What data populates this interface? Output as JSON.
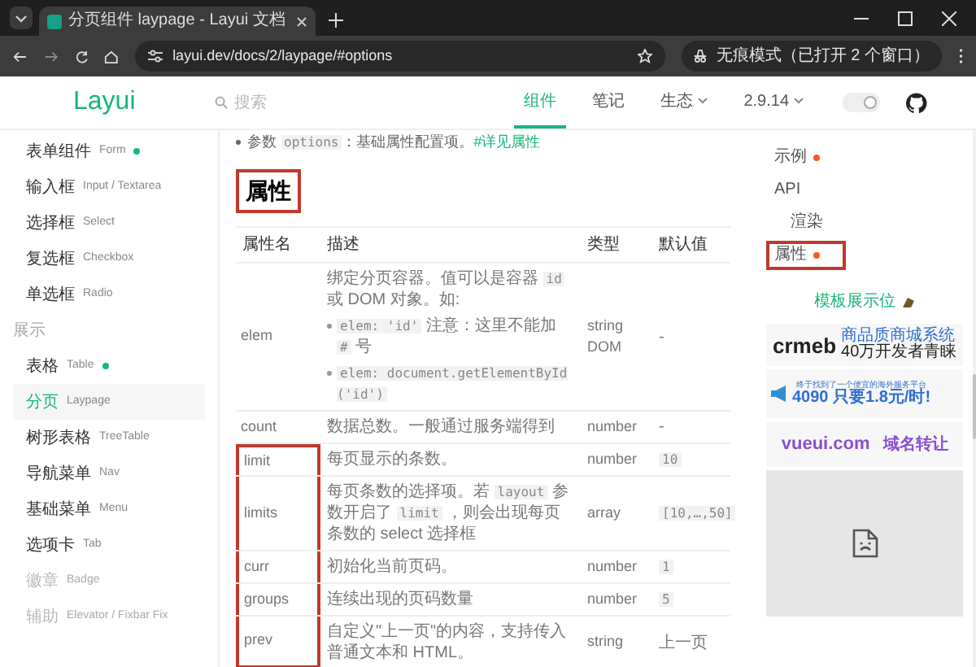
{
  "browser": {
    "tab_title": "分页组件 laypage - Layui 文档",
    "url": "layui.dev/docs/2/laypage/#options",
    "incognito_label": "无痕模式（已打开 2 个窗口）"
  },
  "header": {
    "logo": "Layui",
    "search": {
      "placeholder": "搜索"
    },
    "nav": [
      {
        "label": "组件",
        "selected": true,
        "dropdown": false
      },
      {
        "label": "笔记",
        "selected": false,
        "dropdown": false
      },
      {
        "label": "生态",
        "selected": false,
        "dropdown": true
      },
      {
        "label": "2.9.14",
        "selected": false,
        "dropdown": true
      }
    ],
    "theme_toggle": {
      "on": true
    }
  },
  "sidebar": {
    "items": [
      {
        "kind": "item",
        "label": "表单组件",
        "sub": "Form",
        "dot": true,
        "selected": false,
        "disabled": false
      },
      {
        "kind": "item",
        "label": "输入框",
        "sub": "Input / Textarea",
        "dot": false,
        "selected": false,
        "disabled": false
      },
      {
        "kind": "item",
        "label": "选择框",
        "sub": "Select",
        "dot": false,
        "selected": false,
        "disabled": false
      },
      {
        "kind": "item",
        "label": "复选框",
        "sub": "Checkbox",
        "dot": false,
        "selected": false,
        "disabled": false
      },
      {
        "kind": "item",
        "label": "单选框",
        "sub": "Radio",
        "dot": false,
        "selected": false,
        "disabled": false
      },
      {
        "kind": "section",
        "label": "展示"
      },
      {
        "kind": "item",
        "label": "表格",
        "sub": "Table",
        "dot": true,
        "selected": false,
        "disabled": false
      },
      {
        "kind": "item",
        "label": "分页",
        "sub": "Laypage",
        "dot": false,
        "selected": true,
        "disabled": false
      },
      {
        "kind": "item",
        "label": "树形表格",
        "sub": "TreeTable",
        "dot": false,
        "selected": false,
        "disabled": false
      },
      {
        "kind": "item",
        "label": "导航菜单",
        "sub": "Nav",
        "dot": false,
        "selected": false,
        "disabled": false
      },
      {
        "kind": "item",
        "label": "基础菜单",
        "sub": "Menu",
        "dot": false,
        "selected": false,
        "disabled": false
      },
      {
        "kind": "item",
        "label": "选项卡",
        "sub": "Tab",
        "dot": false,
        "selected": false,
        "disabled": false
      },
      {
        "kind": "item",
        "label": "徽章",
        "sub": "Badge",
        "dot": false,
        "selected": false,
        "disabled": true
      },
      {
        "kind": "item",
        "label": "辅助",
        "sub": "Elevator / Fixbar Fix",
        "dot": false,
        "selected": false,
        "disabled": true
      }
    ]
  },
  "content": {
    "intro": [
      {
        "kind": "text",
        "text": "参数 "
      },
      {
        "kind": "code",
        "text": "options"
      },
      {
        "kind": "text",
        "text": "：基础属性配置项。"
      },
      {
        "kind": "link",
        "text": "#详见属性"
      }
    ],
    "heading": {
      "text": "属性",
      "highlighted": true
    },
    "table": {
      "columns": [
        "属性名",
        "描述",
        "类型",
        "默认值"
      ],
      "rows": [
        {
          "name": "elem",
          "highlighted": false,
          "desc": [
            {
              "kind": "text",
              "text": "绑定分页容器。值可以是容器 "
            },
            {
              "kind": "code",
              "text": "id"
            },
            {
              "kind": "text",
              "text": " 或 DOM 对象。如:"
            }
          ],
          "bullets": [
            [
              {
                "kind": "code",
                "text": "elem: 'id'"
              },
              {
                "kind": "text",
                "text": " 注意：这里不能加 "
              },
              {
                "kind": "code",
                "text": "#"
              },
              {
                "kind": "text",
                "text": " 号"
              }
            ],
            [
              {
                "kind": "code",
                "text": "elem: document.getElementById('id')"
              }
            ]
          ],
          "type": "string DOM",
          "default": {
            "kind": "text",
            "text": "-"
          }
        },
        {
          "name": "count",
          "highlighted": false,
          "desc": [
            {
              "kind": "text",
              "text": "数据总数。一般通过服务端得到"
            }
          ],
          "type": "number",
          "default": {
            "kind": "text",
            "text": "-"
          }
        },
        {
          "name": "limit",
          "highlighted": true,
          "desc": [
            {
              "kind": "text",
              "text": "每页显示的条数。"
            }
          ],
          "type": "number",
          "default": {
            "kind": "code",
            "text": "10"
          }
        },
        {
          "name": "limits",
          "highlighted": true,
          "desc": [
            {
              "kind": "text",
              "text": "每页条数的选择项。若 "
            },
            {
              "kind": "code",
              "text": "layout"
            },
            {
              "kind": "text",
              "text": " 参数开启了 "
            },
            {
              "kind": "code",
              "text": "limit"
            },
            {
              "kind": "text",
              "text": " ，则会出现每页条数的 select 选择框"
            }
          ],
          "type": "array",
          "default": {
            "kind": "code",
            "text": "[10,…,50]"
          }
        },
        {
          "name": "curr",
          "highlighted": true,
          "desc": [
            {
              "kind": "text",
              "text": "初始化当前页码。"
            }
          ],
          "type": "number",
          "default": {
            "kind": "code",
            "text": "1"
          }
        },
        {
          "name": "groups",
          "highlighted": true,
          "desc": [
            {
              "kind": "text",
              "text": "连续出现的页码数量"
            }
          ],
          "type": "number",
          "default": {
            "kind": "code",
            "text": "5"
          }
        },
        {
          "name": "prev",
          "highlighted": true,
          "desc": [
            {
              "kind": "text",
              "text": "自定义\"上一页\"的内容，支持传入普通文本和 HTML。"
            }
          ],
          "type": "string",
          "default": {
            "kind": "text",
            "text": "上一页"
          }
        }
      ]
    }
  },
  "toc": {
    "items": [
      {
        "label": "示例",
        "dot": true,
        "indent": false,
        "highlighted": false
      },
      {
        "label": "API",
        "dot": false,
        "indent": false,
        "highlighted": false
      },
      {
        "label": "渲染",
        "dot": false,
        "indent": true,
        "highlighted": false
      },
      {
        "label": "属性",
        "dot": true,
        "indent": false,
        "highlighted": true
      }
    ],
    "template_link": "模板展示位",
    "ads": [
      {
        "kind": "crmeb",
        "logo": "crmeb",
        "line1": "商品质商城系统",
        "line2": "40万开发者青睐"
      },
      {
        "kind": "server",
        "line1": "终于找到了一个便宜的海外服务平台",
        "line2": "4090 只要1.8元/时!"
      },
      {
        "kind": "domain",
        "site": "vueui.com",
        "action": "域名转让"
      },
      {
        "kind": "broken"
      }
    ]
  }
}
